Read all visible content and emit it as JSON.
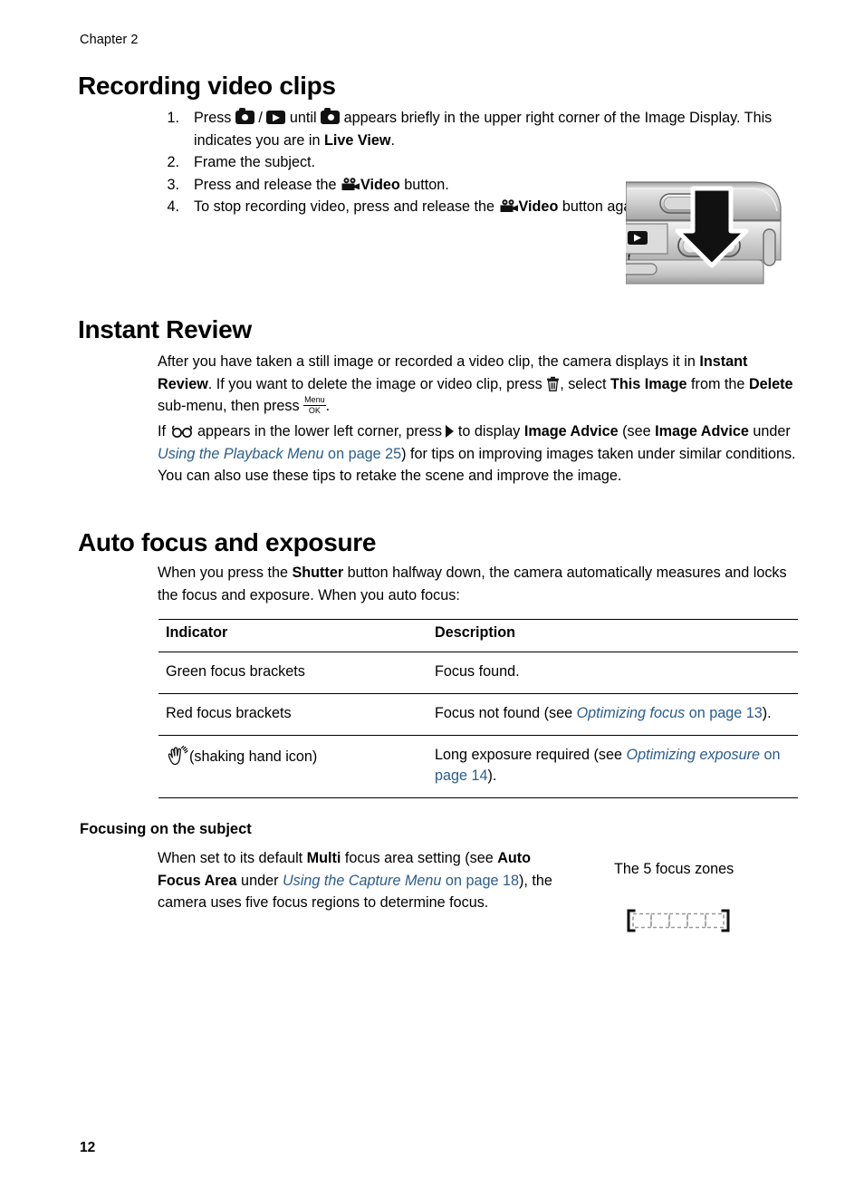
{
  "page": {
    "chapter_label": "Chapter 2",
    "page_number": "12"
  },
  "sections": {
    "recording_video_clips": {
      "heading": "Recording video clips",
      "steps": [
        {
          "number": "1.",
          "parts": {
            "a": "Press ",
            "b": " / ",
            "c": " until ",
            "d": " appears briefly in the upper right corner of the Image Display. This indicates you are in ",
            "e": "Live View",
            "f": "."
          }
        },
        {
          "number": "2.",
          "text": "Frame the subject."
        },
        {
          "number": "3.",
          "parts": {
            "a": "Press and release the ",
            "b": "Video",
            "c": " button."
          }
        },
        {
          "number": "4.",
          "parts": {
            "a": "To stop recording video, press and release the ",
            "b": "Video",
            "c": " button again."
          }
        }
      ]
    },
    "instant_review": {
      "heading": "Instant Review",
      "paragraph1": {
        "a": "After you have taken a still image or recorded a video clip, the camera displays it in ",
        "b": "Instant Review",
        "c": ". If you want to delete the image or video clip, press ",
        "d": ", select ",
        "e": "This Image",
        "f": " from the ",
        "g": "Delete",
        "h": " sub-menu, then press ",
        "i": "."
      },
      "paragraph2": {
        "a": "If ",
        "b": " appears in the lower left corner, press ",
        "c": " to display ",
        "d": "Image Advice",
        "e": " (see ",
        "f": "Image Advice",
        "g": " under ",
        "h": "Using the Playback Menu",
        "i": " on page 25",
        "j": ") for tips on improving images taken under similar conditions. You can also use these tips to retake the scene and improve the image."
      }
    },
    "auto_focus_and_exposure": {
      "heading": "Auto focus and exposure",
      "paragraph": {
        "a": "When you press the ",
        "b": "Shutter",
        "c": " button halfway down, the camera automatically measures and locks the focus and exposure. When you auto focus:"
      },
      "table": {
        "headers": [
          "Indicator",
          "Description"
        ],
        "rows": [
          {
            "indicator": "Green focus brackets",
            "indicator_icon": null,
            "description": {
              "a": "Focus found.",
              "link_italic": "",
              "link_plain": "",
              "tail": ""
            }
          },
          {
            "indicator": "Red focus brackets",
            "indicator_icon": null,
            "description": {
              "a": "Focus not found (see ",
              "link_italic": "Optimizing focus",
              "link_plain": " on page 13",
              "tail": ")."
            }
          },
          {
            "indicator": "(shaking hand icon)",
            "indicator_icon": "shaking-hand-icon",
            "description": {
              "a": "Long exposure required (see ",
              "link_italic": "Optimizing exposure",
              "link_plain": " on page 14",
              "tail": ")."
            }
          }
        ]
      }
    },
    "focusing_on_the_subject": {
      "heading": "Focusing on the subject",
      "paragraph": {
        "a": "When set to its default ",
        "b": "Multi",
        "c": " focus area setting (see ",
        "d": "Auto Focus Area",
        "e": " under ",
        "f": "Using the Capture Menu",
        "g": " on page 18",
        "h": "), the camera uses five focus regions to determine focus."
      },
      "figure_caption": "The 5 focus zones"
    }
  },
  "icons": {
    "still_camera": "still-camera-icon",
    "playback": "playback-icon",
    "video_camera": "video-camera-icon",
    "trash": "trash-icon",
    "menu_ok_top": "Menu",
    "menu_ok_bottom": "OK",
    "eyeglasses": "eyeglasses-icon",
    "arrow_right": "arrow-right-icon",
    "shaking_hand": "shaking-hand-icon"
  },
  "colors": {
    "text": "#000000",
    "link": "#2b5c8a",
    "rule": "#000000",
    "focus_zone_bracket": "#111111",
    "focus_zone_dash": "#9a9a9a"
  }
}
